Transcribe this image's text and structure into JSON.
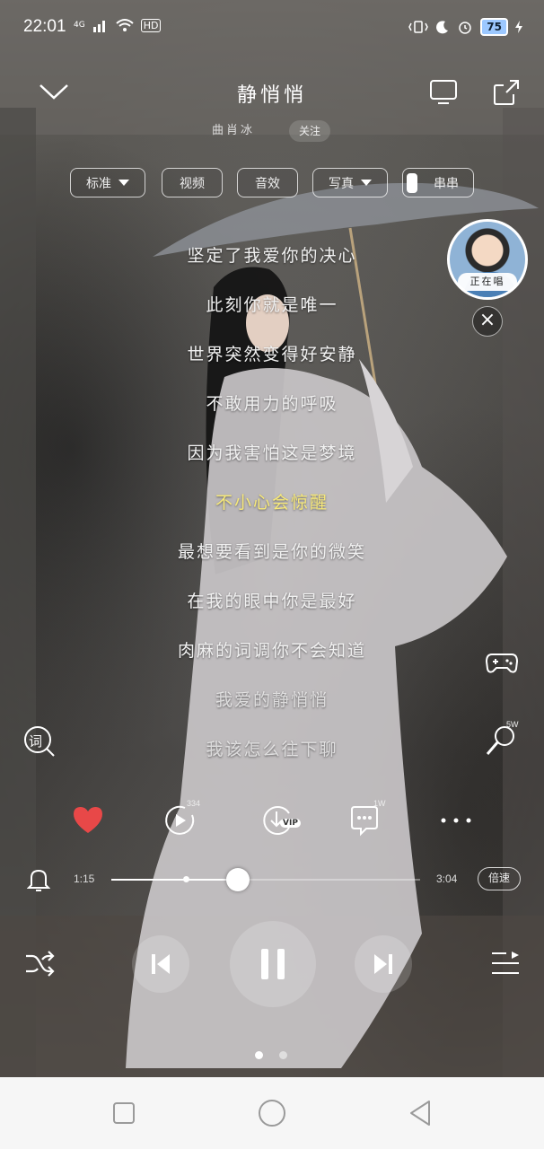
{
  "status_bar": {
    "time": "22:01",
    "network": "4G",
    "hd": "HD",
    "battery": "75"
  },
  "header": {
    "title": "静悄悄",
    "subtitle": "曲肖冰",
    "follow_label": "关注"
  },
  "chips": [
    {
      "label": "标准",
      "dropdown": true
    },
    {
      "label": "视频",
      "dropdown": false
    },
    {
      "label": "音效",
      "dropdown": false
    },
    {
      "label": "写真",
      "dropdown": true
    },
    {
      "label": "串串",
      "dropdown": false
    }
  ],
  "lyrics": {
    "active_index": 5,
    "lines": [
      "坚定了我爱你的决心",
      "此刻你就是唯一",
      "世界突然变得好安静",
      "不敢用力的呼吸",
      "因为我害怕这是梦境",
      "不小心会惊醒",
      "最想要看到是你的微笑",
      "在我的眼中你是最好",
      "肉麻的词调你不会知道",
      "我爱的静悄悄",
      "我该怎么往下聊"
    ]
  },
  "singer_bubble": {
    "label": "正在唱"
  },
  "side": {
    "lyrics_icon_label": "词",
    "karaoke_count": "5W"
  },
  "actions": {
    "play_count": "334",
    "download_badge": "VIP",
    "comment_count": "1W"
  },
  "progress": {
    "current": "1:15",
    "total": "3:04",
    "played_fraction": 0.41,
    "buffered_fraction": 0.24,
    "speed_label": "倍速"
  },
  "colors": {
    "heart": "#e84848",
    "active_lyric": "#f7e97a"
  },
  "pager": {
    "count": 2,
    "active": 0
  }
}
